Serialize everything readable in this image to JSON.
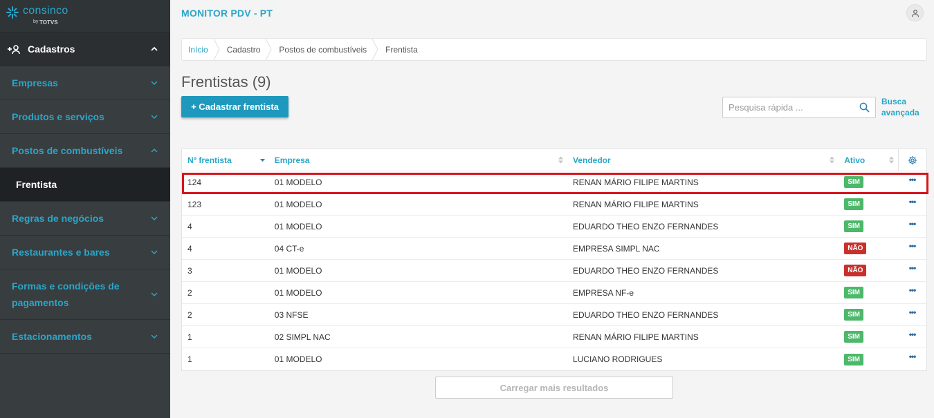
{
  "brand": {
    "name": "consinco",
    "by": "by",
    "totvs": "TOTVS"
  },
  "header": {
    "title": "MONITOR PDV - PT"
  },
  "sidebar": {
    "section": "Cadastros",
    "items": [
      {
        "label": "Empresas"
      },
      {
        "label": "Produtos e serviços"
      },
      {
        "label": "Postos de combustíveis"
      },
      {
        "label": "Frentista"
      },
      {
        "label": "Regras de negócios"
      },
      {
        "label": "Restaurantes e bares"
      },
      {
        "label": "Formas e condições de pagamentos"
      },
      {
        "label": "Estacionamentos"
      }
    ]
  },
  "breadcrumb": [
    "Início",
    "Cadastro",
    "Postos de combustíveis",
    "Frentista"
  ],
  "page": {
    "title": "Frentistas (9)",
    "add_button": "+ Cadastrar frentista",
    "search_placeholder": "Pesquisa rápida ...",
    "advanced_search_line1": "Busca",
    "advanced_search_line2": "avançada",
    "load_more": "Carregar mais resultados"
  },
  "table": {
    "headers": [
      "Nº frentista",
      "Empresa",
      "Vendedor",
      "Ativo"
    ],
    "rows": [
      {
        "num": "124",
        "empresa": "01 MODELO",
        "vendedor": "RENAN MÁRIO FILIPE MARTINS",
        "ativo": "SIM"
      },
      {
        "num": "123",
        "empresa": "01 MODELO",
        "vendedor": "RENAN MÁRIO FILIPE MARTINS",
        "ativo": "SIM"
      },
      {
        "num": "4",
        "empresa": "01 MODELO",
        "vendedor": "EDUARDO THEO ENZO FERNANDES",
        "ativo": "SIM"
      },
      {
        "num": "4",
        "empresa": "04 CT-e",
        "vendedor": "EMPRESA SIMPL NAC",
        "ativo": "NÃO"
      },
      {
        "num": "3",
        "empresa": "01 MODELO",
        "vendedor": "EDUARDO THEO ENZO FERNANDES",
        "ativo": "NÃO"
      },
      {
        "num": "2",
        "empresa": "01 MODELO",
        "vendedor": "EMPRESA NF-e",
        "ativo": "SIM"
      },
      {
        "num": "2",
        "empresa": "03 NFSE",
        "vendedor": "EDUARDO THEO ENZO FERNANDES",
        "ativo": "SIM"
      },
      {
        "num": "1",
        "empresa": "02 SIMPL NAC",
        "vendedor": "RENAN MÁRIO FILIPE MARTINS",
        "ativo": "SIM"
      },
      {
        "num": "1",
        "empresa": "01 MODELO",
        "vendedor": "LUCIANO RODRIGUES",
        "ativo": "SIM"
      }
    ],
    "row_action": "•••"
  },
  "colors": {
    "accent": "#2aa6c8",
    "primary_button": "#1e99bd",
    "sim": "#4cb86a",
    "nao": "#c9302c",
    "highlight": "#d7141c"
  }
}
